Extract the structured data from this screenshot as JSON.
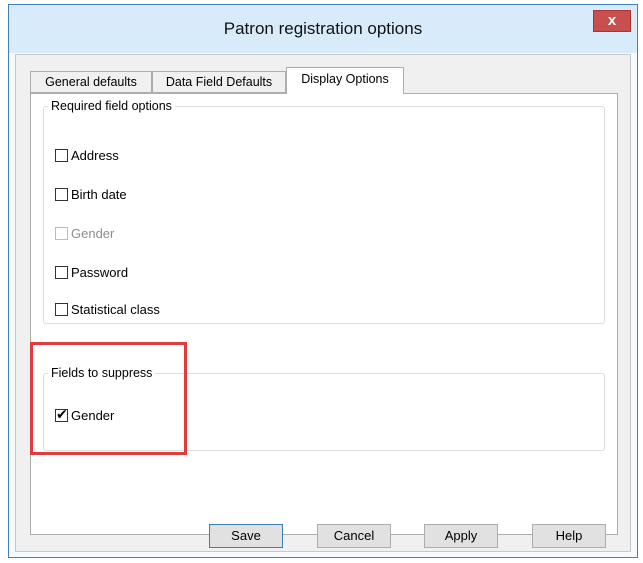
{
  "window": {
    "title": "Patron registration options",
    "close_label": "x"
  },
  "tabs": [
    {
      "label": "General defaults"
    },
    {
      "label": "Data Field Defaults"
    },
    {
      "label": "Display Options"
    }
  ],
  "required_group": {
    "legend": "Required field options",
    "items": [
      {
        "label": "Address",
        "checked": false,
        "disabled": false
      },
      {
        "label": "Birth date",
        "checked": false,
        "disabled": false
      },
      {
        "label": "Gender",
        "checked": false,
        "disabled": true
      },
      {
        "label": "Password",
        "checked": false,
        "disabled": false
      },
      {
        "label": "Statistical class",
        "checked": false,
        "disabled": false
      }
    ]
  },
  "suppress_group": {
    "legend": "Fields to suppress",
    "items": [
      {
        "label": "Gender",
        "checked": true,
        "disabled": false
      }
    ]
  },
  "buttons": {
    "save": "Save",
    "cancel": "Cancel",
    "apply": "Apply",
    "help": "Help"
  },
  "colors": {
    "highlight": "#e03c3c",
    "titlebar": "#d8ebfb",
    "close_button": "#c94f4f"
  }
}
